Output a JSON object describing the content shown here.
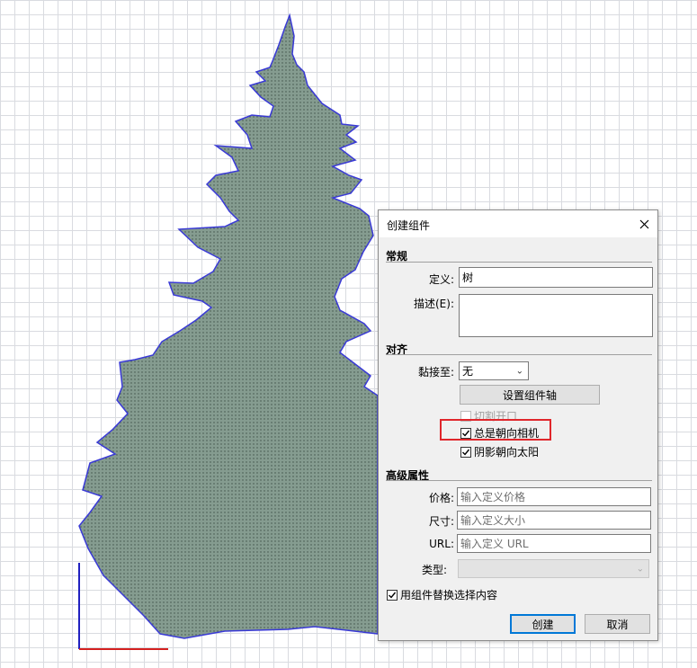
{
  "viewport": {
    "tree_fill_color": "#859c90",
    "tree_edge_color": "#3a3ad6",
    "axis_colors": {
      "red": "#d42020",
      "blue": "#2020c0"
    }
  },
  "dialog": {
    "title": "创建组件",
    "close_icon": "close-icon",
    "sections": {
      "general": "常规",
      "alignment": "对齐",
      "advanced": "高级属性"
    },
    "general": {
      "definition_label": "定义:",
      "definition_value": "树",
      "description_label": "描述(E):",
      "description_value": ""
    },
    "alignment": {
      "glue_label": "黏接至:",
      "glue_value": "无",
      "set_axes_button": "设置组件轴",
      "cut_opening_label": "切割开口",
      "cut_opening_checked": false,
      "always_face_camera_label": "总是朝向相机",
      "always_face_camera_checked": true,
      "shadows_face_sun_label": "阴影朝向太阳",
      "shadows_face_sun_checked": true
    },
    "advanced": {
      "price_label": "价格:",
      "price_placeholder": "输入定义价格",
      "size_label": "尺寸:",
      "size_placeholder": "输入定义大小",
      "url_label": "URL:",
      "url_placeholder": "输入定义 URL",
      "type_label": "类型:",
      "type_value": ""
    },
    "replace_selection_label": "用组件替换选择内容",
    "replace_selection_checked": true,
    "create_button": "创建",
    "cancel_button": "取消"
  }
}
